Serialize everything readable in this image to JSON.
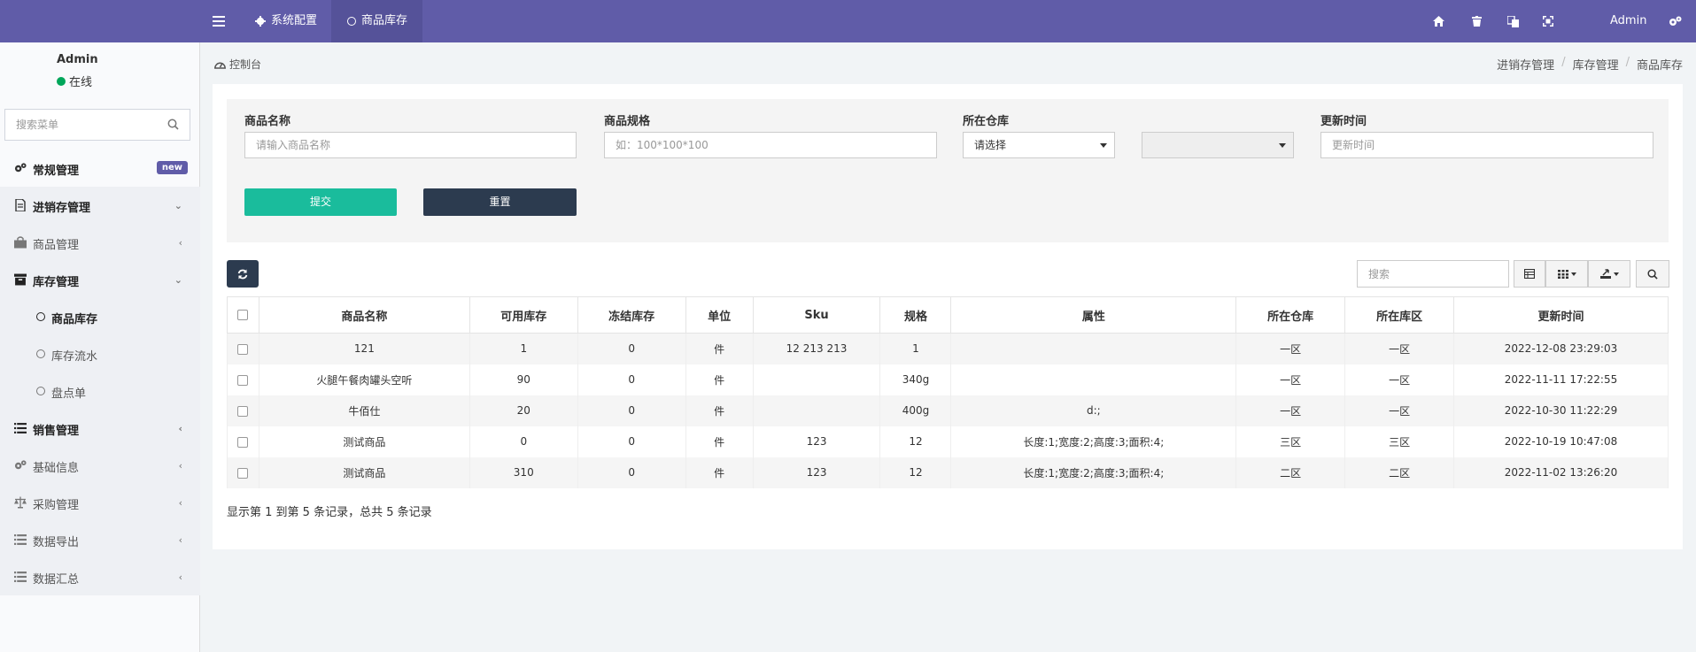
{
  "topbar": {
    "menu_icon": "bars-icon",
    "tabs": [
      {
        "label": "系统配置",
        "icon": "gear-icon"
      },
      {
        "label": "商品库存",
        "icon": "circle-icon"
      }
    ],
    "user": "Admin",
    "right_icons": [
      "home-icon",
      "trash-icon",
      "translate-icon",
      "fullscreen-icon",
      "cogs-icon"
    ],
    "colors": {
      "bar": "#605ca8",
      "active_tab": "#555299"
    }
  },
  "sidebar": {
    "user_name": "Admin",
    "status": "在线",
    "search_placeholder": "搜索菜单",
    "items": [
      {
        "label": "常规管理",
        "badge": "new",
        "icon": "cogs-icon"
      },
      {
        "label": "进销存管理",
        "icon": "file-icon"
      },
      {
        "label": "商品管理",
        "icon": "shopping-bag-icon"
      },
      {
        "label": "库存管理",
        "icon": "archive-icon"
      },
      {
        "label": "商品库存",
        "icon": "circle-icon"
      },
      {
        "label": "库存流水",
        "icon": "circle-icon"
      },
      {
        "label": "盘点单",
        "icon": "circle-icon"
      },
      {
        "label": "销售管理",
        "icon": "list-icon"
      },
      {
        "label": "基础信息",
        "icon": "cogs-icon"
      },
      {
        "label": "采购管理",
        "icon": "balance-icon"
      },
      {
        "label": "数据导出",
        "icon": "list-icon"
      },
      {
        "label": "数据汇总",
        "icon": "list-icon"
      }
    ]
  },
  "header": {
    "dashboard_label": "控制台",
    "breadcrumb": [
      "进销存管理",
      "库存管理",
      "商品库存"
    ]
  },
  "filters": {
    "name_label": "商品名称",
    "name_placeholder": "请输入商品名称",
    "spec_label": "商品规格",
    "spec_placeholder": "如：100*100*100",
    "warehouse_label": "所在仓库",
    "warehouse_select": "请选择",
    "update_label": "更新时间",
    "update_placeholder": "更新时间",
    "submit_label": "提交",
    "reset_label": "重置"
  },
  "toolbar": {
    "search_placeholder": "搜索"
  },
  "table": {
    "columns": [
      "商品名称",
      "可用库存",
      "冻结库存",
      "单位",
      "Sku",
      "规格",
      "属性",
      "所在仓库",
      "所在库区",
      "更新时间"
    ],
    "rows": [
      [
        "121",
        "1",
        "0",
        "件",
        "12 213 213",
        "1",
        "",
        "一区",
        "一区",
        "2022-12-08 23:29:03"
      ],
      [
        "火腿午餐肉罐头空听",
        "90",
        "0",
        "件",
        "",
        "340g",
        "",
        "一区",
        "一区",
        "2022-11-11 17:22:55"
      ],
      [
        "牛佰仕",
        "20",
        "0",
        "件",
        "",
        "400g",
        "d:;",
        "一区",
        "一区",
        "2022-10-30 11:22:29"
      ],
      [
        "测试商品",
        "0",
        "0",
        "件",
        "123",
        "12",
        "长度:1;宽度:2;高度:3;面积:4;",
        "三区",
        "三区",
        "2022-10-19 10:47:08"
      ],
      [
        "测试商品",
        "310",
        "0",
        "件",
        "123",
        "12",
        "长度:1;宽度:2;高度:3;面积:4;",
        "二区",
        "二区",
        "2022-11-02 13:26:20"
      ]
    ]
  },
  "footer": {
    "summary": "显示第 1 到第 5 条记录，总共 5 条记录"
  }
}
